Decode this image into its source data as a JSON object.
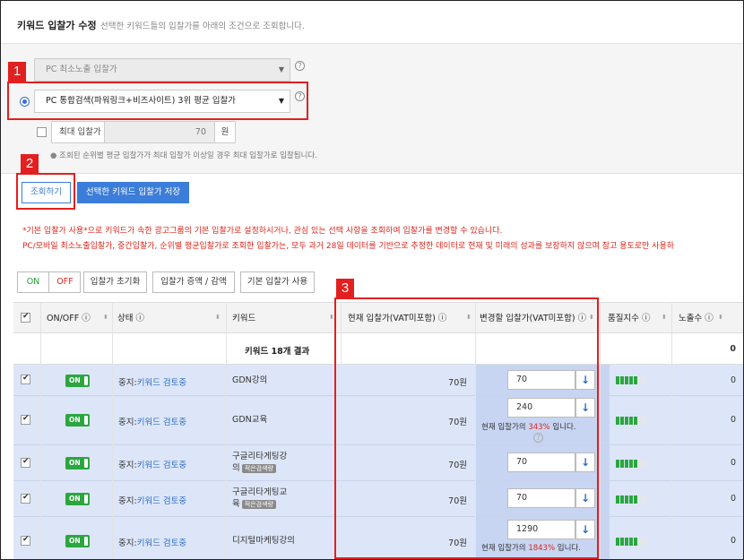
{
  "header": {
    "title": "키워드 입찰가 수정",
    "description": "선택한 키워드들의 입찰가를 아래의 조건으로 조회합니다."
  },
  "bid_options": {
    "pc_min_exposure": "PC 최소노출 입찰가",
    "pc_integrated_search": "PC 통합검색(파워링크+비즈사이트) 3위 평균 입찰가",
    "help_mark": "?"
  },
  "max_bid": {
    "label": "최대 입찰가",
    "value": "70",
    "unit": "원",
    "note": "조회된 순위별 평균 입찰가가 최대 입찰가 이상일 경우 최대 입찰가로 입찰됩니다."
  },
  "actions": {
    "search": "조회하기",
    "save": "선택한 키워드 입찰가 저장"
  },
  "warnings": [
    "*기본 입찰가 사용*으로 키워드가 속한 광고그룹의 기본 입찰가로 설정하시거나, 관심 있는 선택 사항을 조회하여 입찰가를 변경할 수 있습니다.",
    "PC/모바일 최소노출입찰가, 중간입찰가, 순위별 평균입찰가로 조회한 입찰가는, 모두 과거 28일 데이터를 기반으로 추정한 데이터로 현재 및 미래의 성과를 보장하지 않으며 참고 용도로만 사용하"
  ],
  "toolbar": {
    "on": "ON",
    "off": "OFF",
    "reset": "입찰가 초기화",
    "adjust": "입찰가 증액 / 감액",
    "default": "기본 입찰가 사용"
  },
  "table": {
    "columns": {
      "onoff": "ON/OFF",
      "status": "상태",
      "keyword": "키워드",
      "current_bid": "현재 입찰가(VAT미포함)",
      "new_bid": "변경할 입찰가(VAT미포함)",
      "quality": "품질지수",
      "impressions": "노출수"
    },
    "result_label": "키워드 18개 결과",
    "result_impressions": "0",
    "rows": [
      {
        "toggle": "ON",
        "status_prefix": "중지:",
        "status_link": "키워드 검토중",
        "keyword": "GDN강의",
        "badge": "",
        "current_bid": "70원",
        "new_bid": "70",
        "note_pre": "",
        "note_pct": "",
        "note_post": "",
        "quality": 5,
        "impressions": "0"
      },
      {
        "toggle": "ON",
        "status_prefix": "중지:",
        "status_link": "키워드 검토중",
        "keyword": "GDN교육",
        "badge": "",
        "current_bid": "70원",
        "new_bid": "240",
        "note_pre": "현재 입찰가의 ",
        "note_pct": "343%",
        "note_post": " 입니다.",
        "quality": 5,
        "impressions": "0"
      },
      {
        "toggle": "ON",
        "status_prefix": "중지:",
        "status_link": "키워드 검토중",
        "keyword": "구글리타게팅강",
        "keyword2": "의",
        "badge": "적은검색량",
        "current_bid": "70원",
        "new_bid": "70",
        "note_pre": "",
        "note_pct": "",
        "note_post": "",
        "quality": 5,
        "impressions": "0"
      },
      {
        "toggle": "ON",
        "status_prefix": "중지:",
        "status_link": "키워드 검토중",
        "keyword": "구글리타게팅교",
        "keyword2": "육",
        "badge": "적은검색량",
        "current_bid": "70원",
        "new_bid": "70",
        "note_pre": "",
        "note_pct": "",
        "note_post": "",
        "quality": 5,
        "impressions": "0"
      },
      {
        "toggle": "ON",
        "status_prefix": "중지:",
        "status_link": "키워드 검토중",
        "keyword": "디지털마케팅강의",
        "badge": "",
        "current_bid": "70원",
        "new_bid": "1290",
        "note_pre": "현재 입찰가의 ",
        "note_pct": "1843%",
        "note_post": " 입니다.",
        "quality": 5,
        "impressions": "0"
      }
    ]
  },
  "callouts": [
    "1",
    "2",
    "3"
  ],
  "colors": {
    "accent": "#3b7dd8",
    "callout_red": "#e2201f",
    "on_green": "#2ba640",
    "row_selected": "#dde6f8"
  }
}
